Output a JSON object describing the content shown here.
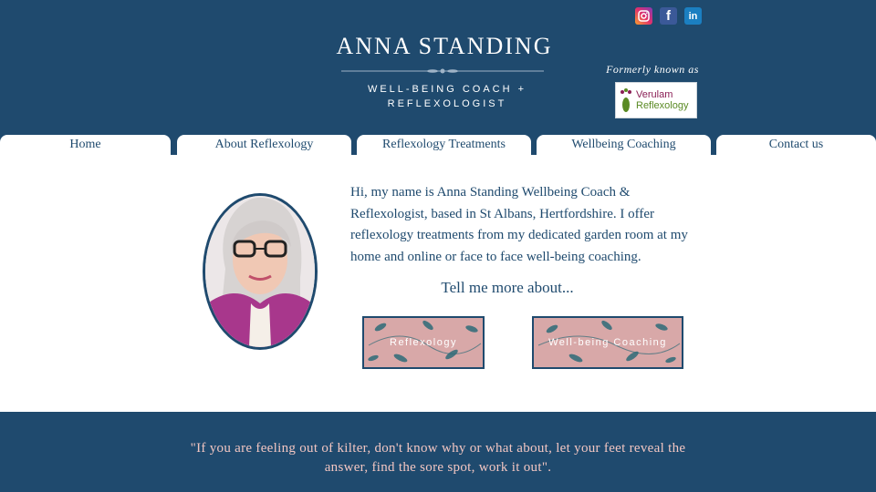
{
  "header": {
    "title": "ANNA STANDING",
    "subtitle": "WELL-BEING COACH + REFLEXOLOGIST",
    "formerly": "Formerly known as",
    "logo": {
      "line1": "Verulam",
      "line2": "Reflexology"
    }
  },
  "social": [
    "instagram-icon",
    "facebook-icon",
    "linkedin-icon"
  ],
  "nav": {
    "items": [
      {
        "label": "Home"
      },
      {
        "label": "About Reflexology"
      },
      {
        "label": "Reflexology Treatments"
      },
      {
        "label": "Wellbeing Coaching"
      },
      {
        "label": "Contact us"
      }
    ]
  },
  "main": {
    "intro": "Hi, my name is Anna Standing Wellbeing Coach & Reflexologist, based in St Albans, Hertfordshire. I offer reflexology treatments from my dedicated garden room at my home and online or face to face well-being coaching.",
    "tell_more": "Tell me more about...",
    "buttons": {
      "reflexology": "Reflexology",
      "coaching": "Well-being Coaching"
    }
  },
  "quote": "\"If you are feeling out of kilter, don't know why or what about, let your feet reveal the answer, find the sore spot, work it out\".",
  "colors": {
    "navy": "#1f4a6e",
    "pink": "#d8a8a8",
    "quote_text": "#f2c6c2"
  }
}
